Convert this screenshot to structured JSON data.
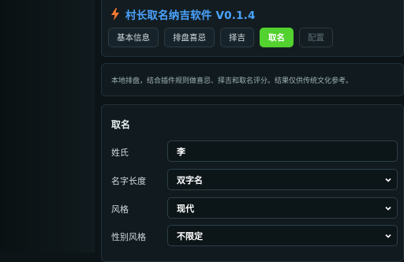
{
  "app": {
    "title": "村长取名纳吉软件 V0.1.4"
  },
  "tabs": [
    {
      "label": "基本信息",
      "state": "normal"
    },
    {
      "label": "排盘喜忌",
      "state": "normal"
    },
    {
      "label": "择吉",
      "state": "normal"
    },
    {
      "label": "取名",
      "state": "active"
    },
    {
      "label": "配置",
      "state": "disabled"
    }
  ],
  "note": {
    "text": "本地排盘，结合插件规则做喜忌、择吉和取名评分。结果仅供传统文化参考。"
  },
  "form": {
    "title": "取名",
    "surname": {
      "label": "姓氏",
      "value": "李"
    },
    "name_length": {
      "label": "名字长度",
      "value": "双字名"
    },
    "style": {
      "label": "风格",
      "value": "现代"
    },
    "gender_style": {
      "label": "性别风格",
      "value": "不限定"
    }
  },
  "colors": {
    "accent_title": "#4aa3ff",
    "active_tab": "#52d12f",
    "bolt": "#ff7a2f"
  }
}
